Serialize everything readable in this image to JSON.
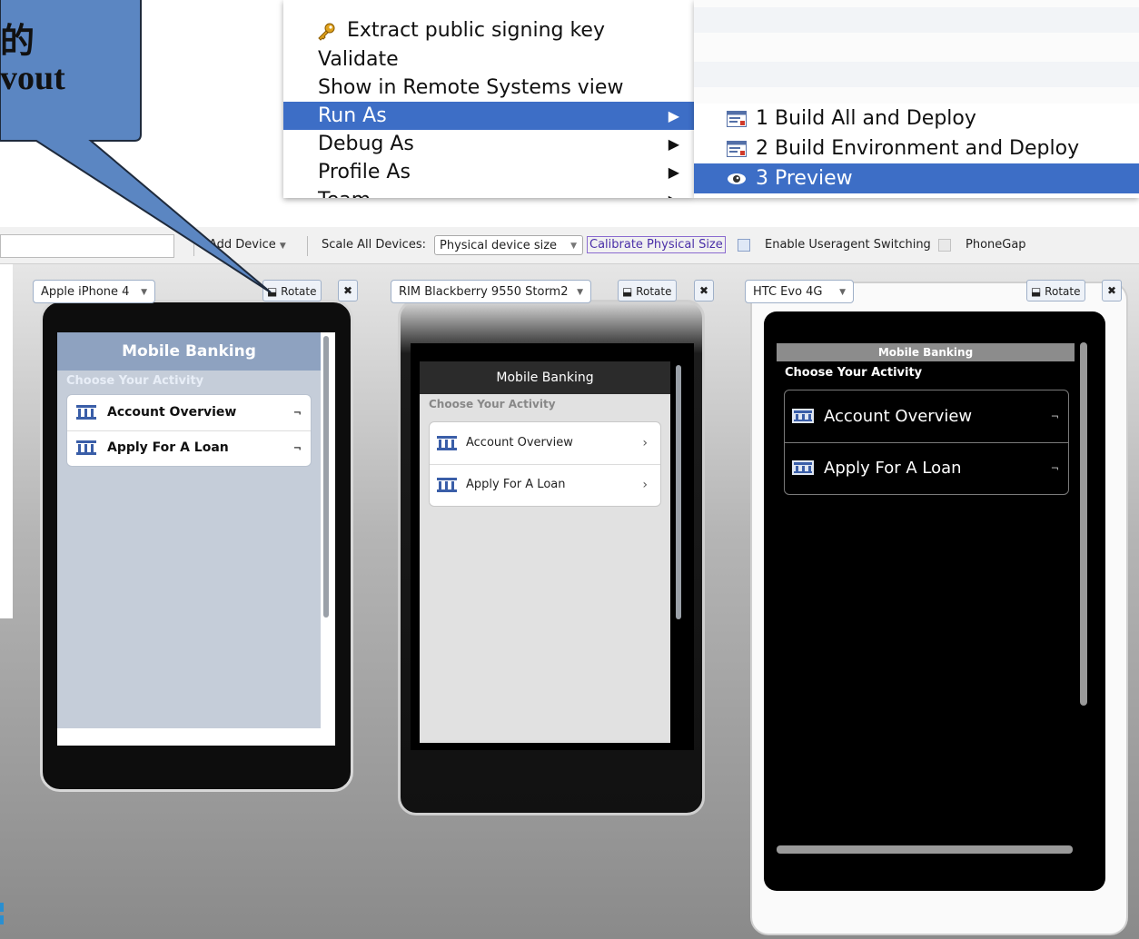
{
  "callout": {
    "line1": "的",
    "line2": "vout",
    "fill": "#5b86c2"
  },
  "context_menu": {
    "items": [
      {
        "label": "Extract public signing key",
        "icon": "key-icon"
      },
      {
        "label": "Validate"
      },
      {
        "label": "Show in Remote Systems view"
      },
      {
        "label": "Run As",
        "arrow": "▶"
      },
      {
        "label": "Debug As",
        "arrow": "▶"
      },
      {
        "label": "Profile As",
        "arrow": "▶"
      },
      {
        "label": "Team",
        "arrow": "▶"
      }
    ],
    "highlight": "#3d6ec6"
  },
  "submenu": {
    "items": [
      {
        "label": "1 Build All and Deploy",
        "icon": "build-icon"
      },
      {
        "label": "2 Build Environment and Deploy",
        "icon": "build-icon"
      },
      {
        "label": "3 Preview",
        "icon": "eye-icon"
      }
    ]
  },
  "toolbar": {
    "add_device": "Add Device",
    "scale_label": "Scale All Devices:",
    "scale_value": "Physical device size",
    "calibrate": "Calibrate Physical Size",
    "useragent": "Enable Useragent Switching",
    "phonegap": "PhoneGap"
  },
  "devices": {
    "rotate_label": "Rotate",
    "close_glyph": "✖",
    "iphone": {
      "name": "Apple iPhone 4",
      "app_title": "Mobile Banking",
      "subtitle": "Choose Your Activity",
      "items": [
        "Account Overview",
        "Apply For A Loan"
      ]
    },
    "blackberry": {
      "name": "RIM Blackberry 9550 Storm2",
      "app_title": "Mobile Banking",
      "subtitle": "Choose Your Activity",
      "items": [
        "Account Overview",
        "Apply For A Loan"
      ]
    },
    "htc": {
      "name": "HTC Evo 4G",
      "app_title": "Mobile Banking",
      "subtitle": "Choose Your Activity",
      "items": [
        "Account Overview",
        "Apply For A Loan"
      ]
    }
  }
}
